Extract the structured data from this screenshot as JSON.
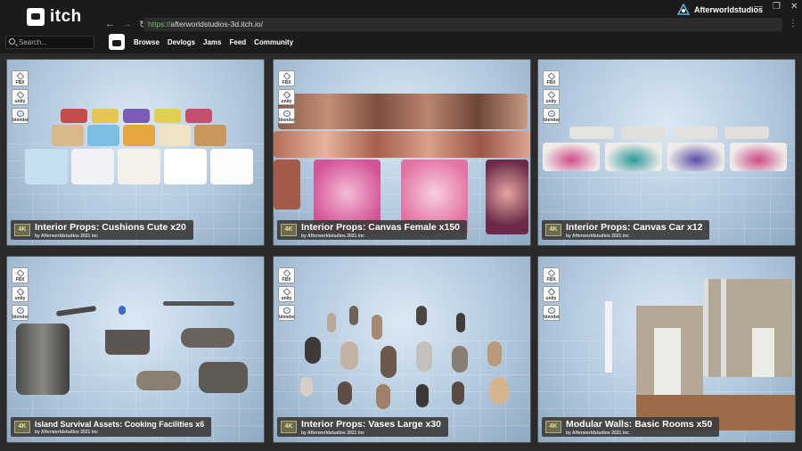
{
  "brand": {
    "name": "itch"
  },
  "url": {
    "scheme": "https://",
    "rest": "afterworldstudios-3d.itch.io/"
  },
  "user": {
    "name": "Afterworldstudios"
  },
  "search": {
    "placeholder": "Search..."
  },
  "nav": [
    "Browse",
    "Devlogs",
    "Jams",
    "Feed",
    "Community"
  ],
  "badges": [
    "FBX",
    "unity",
    "blender"
  ],
  "cards": [
    {
      "title": "Interior Props: Cushions Cute x20",
      "by": "by Afterworldstudios 2021 inc",
      "k": "4K"
    },
    {
      "title": "Interior Props: Canvas Female x150",
      "by": "by Afterworldstudios 2021 inc",
      "k": "4K"
    },
    {
      "title": "Interior Props: Canvas Car x12",
      "by": "by Afterworldstudios 2021 inc",
      "k": "4K"
    },
    {
      "title": "Island Survival Assets: Cooking Facilities x6",
      "by": "by Afterworldstudios 2021 inc",
      "k": "4K"
    },
    {
      "title": "Interior Props: Vases Large x30",
      "by": "by Afterworldstudios 2021 inc",
      "k": "4K"
    },
    {
      "title": "Modular Walls: Basic Rooms x50",
      "by": "by Afterworldstudios 2021 inc",
      "k": "4K"
    }
  ]
}
